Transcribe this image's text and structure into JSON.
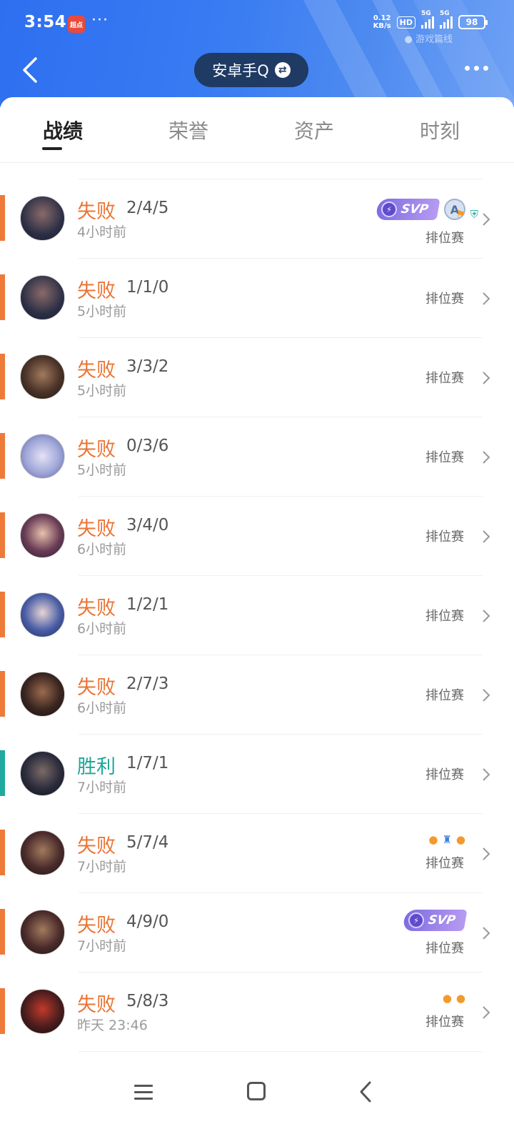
{
  "status_bar": {
    "time": "3:54",
    "notif_app": "超点",
    "more": "···",
    "net_speed_top": "0.12",
    "net_speed_bottom": "KB/s",
    "hd": "HD",
    "sig1": "5G",
    "sig2": "5G",
    "battery": "98",
    "watermark": "● 游戏篇线"
  },
  "header": {
    "account_label": "安卓手Q",
    "swap_icon": "⇄"
  },
  "tabs": [
    {
      "label": "战绩",
      "active": true
    },
    {
      "label": "荣誉",
      "active": false
    },
    {
      "label": "资产",
      "active": false
    },
    {
      "label": "时刻",
      "active": false
    }
  ],
  "matches": [
    {
      "result": "失败",
      "kda": "2/4/5",
      "time": "4小时前",
      "mode": "排位赛"
    },
    {
      "result": "失败",
      "kda": "1/1/0",
      "time": "5小时前",
      "mode": "排位赛"
    },
    {
      "result": "失败",
      "kda": "3/3/2",
      "time": "5小时前",
      "mode": "排位赛"
    },
    {
      "result": "失败",
      "kda": "0/3/6",
      "time": "5小时前",
      "mode": "排位赛"
    },
    {
      "result": "失败",
      "kda": "3/4/0",
      "time": "6小时前",
      "mode": "排位赛"
    },
    {
      "result": "失败",
      "kda": "1/2/1",
      "time": "6小时前",
      "mode": "排位赛"
    },
    {
      "result": "失败",
      "kda": "2/7/3",
      "time": "6小时前",
      "mode": "排位赛"
    },
    {
      "result": "胜利",
      "kda": "1/7/1",
      "time": "7小时前",
      "mode": "排位赛"
    },
    {
      "result": "失败",
      "kda": "5/7/4",
      "time": "7小时前",
      "mode": "排位赛"
    },
    {
      "result": "失败",
      "kda": "4/9/0",
      "time": "7小时前",
      "mode": "排位赛"
    },
    {
      "result": "失败",
      "kda": "5/8/3",
      "time": "昨天 23:46",
      "mode": "排位赛"
    }
  ],
  "badges": {
    "svp": "SVP",
    "a_badge": "A"
  },
  "colors": {
    "lose": "#ea7435",
    "win": "#1ea79b"
  }
}
